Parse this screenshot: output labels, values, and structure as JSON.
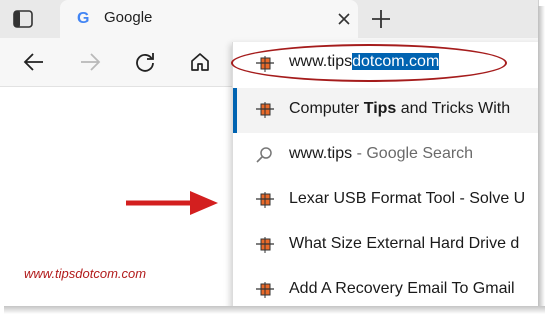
{
  "browser": {
    "tab": {
      "title": "Google",
      "favicon": "G"
    },
    "icons": {
      "tab_actions": "tab-actions-icon",
      "close": "close-icon",
      "new_tab": "plus-icon",
      "back": "back-arrow-icon",
      "forward": "forward-arrow-icon",
      "refresh": "refresh-icon",
      "home": "home-icon"
    }
  },
  "address_bar": {
    "typed_text": "www.tips",
    "autocompleted_text": "dotcom.com",
    "selection_color": "#0063b1"
  },
  "suggestions": [
    {
      "bold": "",
      "before": "Computer ",
      "match": "Tips",
      "after": " and Tricks With",
      "hint": "",
      "icon": "site-favicon"
    },
    {
      "before": "www.tips",
      "match": "",
      "after": "",
      "hint": " - Google Search",
      "icon": "search-icon"
    },
    {
      "before": "Lexar USB Format Tool - Solve U",
      "match": "",
      "after": "",
      "hint": "",
      "icon": "site-favicon"
    },
    {
      "before": "What Size External Hard Drive d",
      "match": "",
      "after": "",
      "hint": "",
      "icon": "site-favicon"
    },
    {
      "before": "Add A Recovery Email To Gmail",
      "match": "",
      "after": "",
      "hint": "",
      "icon": "site-favicon"
    }
  ],
  "annotation": {
    "watermark": "www.tipsdotcom.com",
    "highlight_color": "#a51c1c",
    "arrow_color": "#d31f1f"
  }
}
